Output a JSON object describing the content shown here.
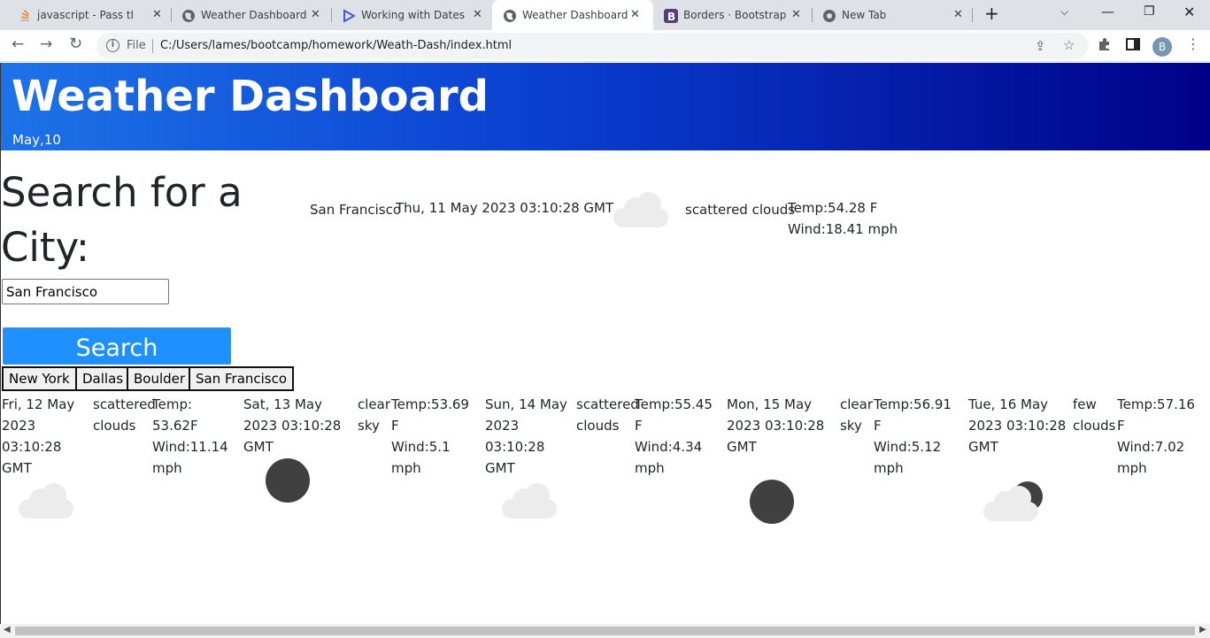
{
  "browser": {
    "tabs": [
      {
        "title": "javascript - Pass the re",
        "icon": "stackoverflow-icon",
        "active": false
      },
      {
        "title": "Weather Dashboard",
        "icon": "globe-icon",
        "active": false
      },
      {
        "title": "Working with Dates ar",
        "icon": "play-icon",
        "active": false
      },
      {
        "title": "Weather Dashboard",
        "icon": "globe-icon",
        "active": true
      },
      {
        "title": "Borders · Bootstrap",
        "icon": "bootstrap-icon",
        "active": false
      },
      {
        "title": "New Tab",
        "icon": "chrome-icon",
        "active": false
      }
    ],
    "file_label": "File",
    "url": "C:/Users/lames/bootcamp/homework/Weath-Dash/index.html",
    "avatar_letter": "B"
  },
  "header": {
    "title": "Weather Dashboard",
    "date": "May,10"
  },
  "search": {
    "heading": "Search for a City:",
    "input_value": "San Francisco",
    "button_label": "Search",
    "history": [
      "New York",
      "Dallas",
      "Boulder",
      "San Francisco"
    ]
  },
  "current": {
    "city": "San Francisco",
    "date": "Thu, 11 May 2023 03:10:28 GMT",
    "icon": "cloud-icon",
    "description": "scattered clouds",
    "temp": "Temp:54.28 F",
    "wind": "Wind:18.41 mph"
  },
  "forecast": [
    {
      "date": "Fri, 12 May 2023 03:10:28 GMT",
      "description": "scattered clouds",
      "temp": "Temp: 53.62F",
      "wind": "Wind:11.14 mph",
      "icon": "cloud-icon"
    },
    {
      "date": "Sat, 13 May 2023 03:10:28 GMT",
      "description": "clear sky",
      "temp": "Temp:53.69 F",
      "wind": "Wind:5.1 mph",
      "icon": "sun-icon"
    },
    {
      "date": "Sun, 14 May 2023 03:10:28 GMT",
      "description": "scattered clouds",
      "temp": "Temp:55.45 F",
      "wind": "Wind:4.34 mph",
      "icon": "cloud-icon"
    },
    {
      "date": "Mon, 15 May 2023 03:10:28 GMT",
      "description": "clear sky",
      "temp": "Temp:56.91 F",
      "wind": "Wind:5.12 mph",
      "icon": "sun-icon"
    },
    {
      "date": "Tue, 16 May 2023 03:10:28 GMT",
      "description": "few clouds",
      "temp": "Temp:57.16 F",
      "wind": "Wind:7.02 mph",
      "icon": "cloud-moon-icon"
    }
  ],
  "colors": {
    "header_start": "#1e73e8",
    "header_end": "#000088",
    "search_button": "#1e90ff"
  }
}
